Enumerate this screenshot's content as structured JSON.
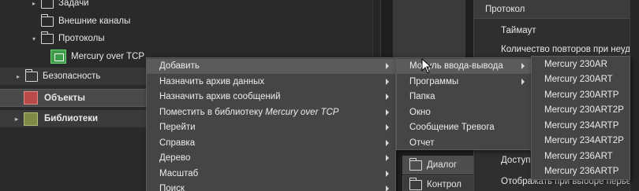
{
  "tree": {
    "items": [
      {
        "label": "Задачи",
        "expander": "▸"
      },
      {
        "label": "Внешние каналы",
        "expander": ""
      },
      {
        "label": "Протоколы",
        "expander": "▾"
      },
      {
        "label": "Mercury over TCP"
      }
    ],
    "security": {
      "label": "Безопасность",
      "expander": "▸"
    },
    "objects": {
      "label": "Объекты"
    },
    "libraries": {
      "label": "Библиотеки",
      "expander": "▸"
    }
  },
  "middle": {
    "items": [
      {
        "label": "Диалог"
      },
      {
        "label": "Контрол"
      }
    ]
  },
  "right_panel": {
    "header": "Протокол",
    "rows": [
      "Таймаут",
      "Количество повторов при неудач",
      "Доступ",
      "Отображать при выборе перьев"
    ]
  },
  "context_menu": {
    "items": [
      {
        "label": "Добавить",
        "submenu": true
      },
      {
        "label": "Назначить архив данных",
        "submenu": true
      },
      {
        "label": "Назначить архив сообщений",
        "submenu": true
      },
      {
        "label": "Поместить в библиотеку ",
        "label_em": "Mercury over TCP",
        "submenu": true
      },
      {
        "label": "Перейти",
        "submenu": true
      },
      {
        "label": "Справка",
        "submenu": true
      },
      {
        "label": "Дерево",
        "submenu": true
      },
      {
        "label": "Масштаб",
        "submenu": true
      },
      {
        "label": "Поиск",
        "submenu": true
      }
    ]
  },
  "add_menu": {
    "items": [
      {
        "label": "Модуль ввода-вывода",
        "submenu": true
      },
      {
        "label": "Программы",
        "submenu": true
      },
      {
        "label": "Папка",
        "submenu": false
      },
      {
        "label": "Окно",
        "submenu": false
      },
      {
        "label": "Сообщение Тревога",
        "submenu": false
      },
      {
        "label": "Отчет",
        "submenu": false
      }
    ]
  },
  "module_menu": {
    "items": [
      "Mercury 230AR",
      "Mercury 230ART",
      "Mercury 230ARTP",
      "Mercury 230ART2P",
      "Mercury 234ARTP",
      "Mercury 234ART2P",
      "Mercury 236ART",
      "Mercury 236ARTP"
    ]
  }
}
